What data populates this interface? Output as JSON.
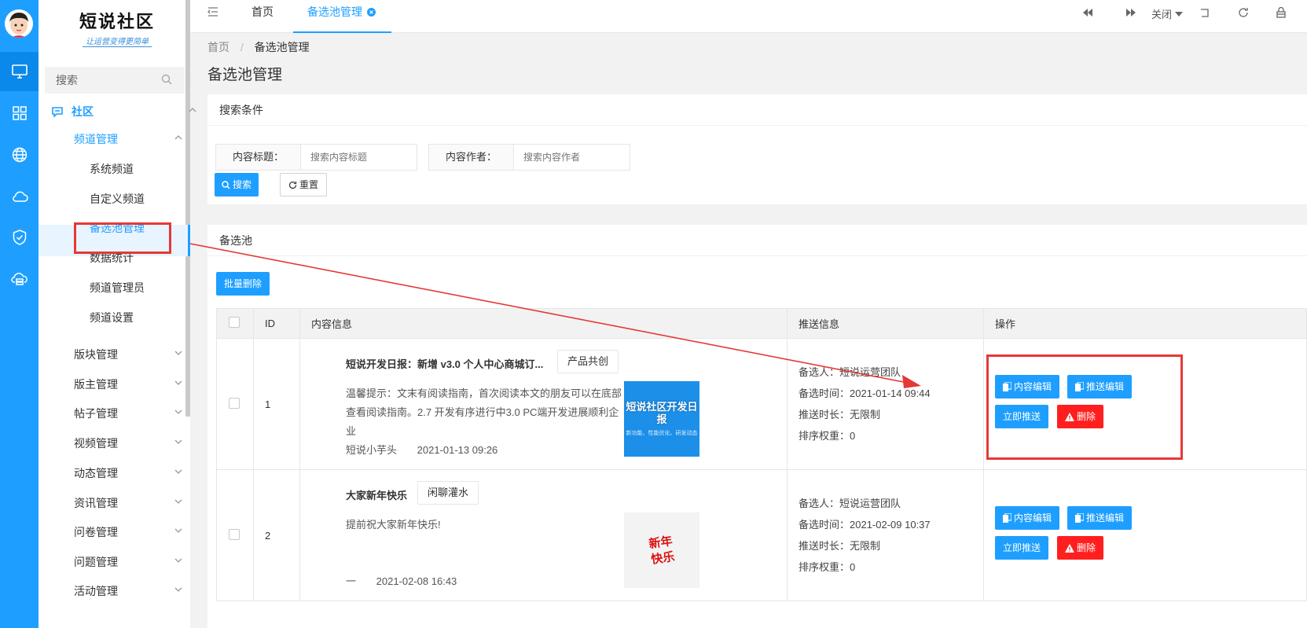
{
  "colors": {
    "primary": "#1e9fff",
    "danger": "#ff1f1f",
    "annotation": "#e53935"
  },
  "brand": {
    "name": "短说社区",
    "slogan": "让运营变得更简单"
  },
  "rail": {
    "icons": [
      "monitor-icon",
      "grid-icon",
      "globe-icon",
      "cloud-icon",
      "shield-check-icon",
      "cloud-server-icon"
    ]
  },
  "sidebar": {
    "search_label": "搜索",
    "group": "社区",
    "subgroup": "频道管理",
    "items": [
      "系统频道",
      "自定义频道",
      "备选池管理",
      "数据统计",
      "频道管理员",
      "频道设置"
    ],
    "sections": [
      "版块管理",
      "版主管理",
      "帖子管理",
      "视频管理",
      "动态管理",
      "资讯管理",
      "问卷管理",
      "问题管理",
      "活动管理"
    ]
  },
  "topbar": {
    "tabs": [
      "首页",
      "备选池管理"
    ],
    "close_label": "关闭"
  },
  "breadcrumb": {
    "home": "首页",
    "sep": "/",
    "current": "备选池管理"
  },
  "page_title": "备选池管理",
  "search_panel": {
    "title": "搜索条件",
    "title_label": "内容标题：",
    "title_placeholder": "搜索内容标题",
    "author_label": "内容作者：",
    "author_placeholder": "搜索内容作者",
    "search_btn": "搜索",
    "reset_btn": "重置"
  },
  "pool": {
    "title": "备选池",
    "batch_delete": "批量删除",
    "columns": [
      "ID",
      "内容信息",
      "推送信息",
      "操作"
    ],
    "rows": [
      {
        "id": "1",
        "title": "短说开发日报：新增 v3.0 个人中心商城订...",
        "tag": "产品共创",
        "desc": "温馨提示：文末有阅读指南，首次阅读本文的朋友可以在底部查看阅读指南。2.7 开发有序进行中3.0 PC端开发进展顺利企业",
        "author": "短说小芋头",
        "time": "2021-01-13 09:26",
        "thumb_text": "短说社区开发日报",
        "thumb_sub": "新功能、性能优化、研发动态",
        "picker": "备选人：短说运营团队",
        "pick_time": "备选时间：2021-01-14 09:44",
        "duration": "推送时长：无限制",
        "weight": "排序权重：0"
      },
      {
        "id": "2",
        "title": "大家新年快乐",
        "tag": "闲聊灌水",
        "desc": "提前祝大家新年快乐!",
        "author": "一",
        "time": "2021-02-08 16:43",
        "thumb_text": "新年快乐",
        "thumb_sub": "",
        "picker": "备选人：短说运营团队",
        "pick_time": "备选时间：2021-02-09 10:37",
        "duration": "推送时长：无限制",
        "weight": "排序权重：0"
      }
    ],
    "actions": {
      "content_edit": "内容编辑",
      "push_edit": "推送编辑",
      "push_now": "立即推送",
      "delete": "删除"
    }
  }
}
